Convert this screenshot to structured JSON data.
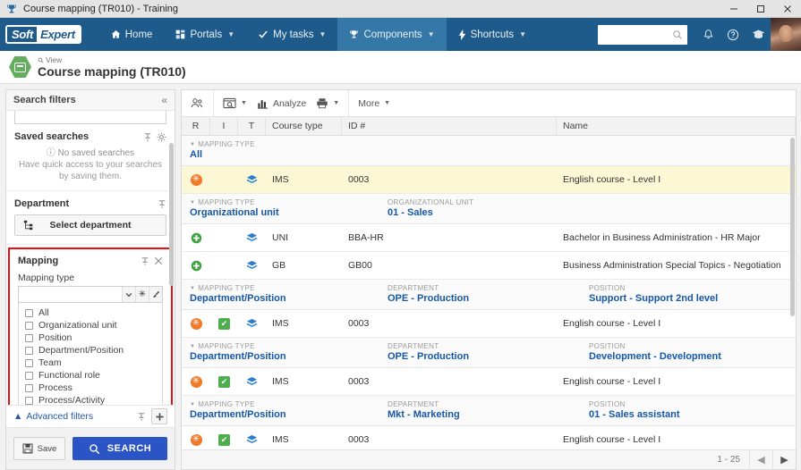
{
  "window": {
    "title": "Course mapping (TR010) - Training",
    "icon": "trophy-icon",
    "minimize": "─",
    "maximize": "☐",
    "close": "✕"
  },
  "nav": {
    "logo_left": "Soft",
    "logo_right": "Expert",
    "items": [
      {
        "label": "Home",
        "icon": "home-icon",
        "caret": false,
        "active": false
      },
      {
        "label": "Portals",
        "icon": "grid-icon",
        "caret": true,
        "active": false
      },
      {
        "label": "My tasks",
        "icon": "check-icon",
        "caret": true,
        "active": false
      },
      {
        "label": "Components",
        "icon": "trophy-icon",
        "caret": true,
        "active": true
      },
      {
        "label": "Shortcuts",
        "icon": "bolt-icon",
        "caret": true,
        "active": false
      }
    ],
    "search_placeholder": "",
    "search_value": "",
    "icons": [
      "search-icon",
      "bell-icon",
      "help-icon",
      "academy-icon",
      "avatar"
    ]
  },
  "page": {
    "breadcrumb": "View",
    "title": "Course mapping (TR010)"
  },
  "filters": {
    "header": "Search filters",
    "collapse_icon": "chevron-double-left-icon",
    "saved_searches": {
      "title": "Saved searches",
      "empty_title": "No saved searches",
      "empty_text": "Have quick access to your searches by saving them.",
      "tools": [
        "pin-icon",
        "gear-icon"
      ]
    },
    "department": {
      "title": "Department",
      "button_label": "Select department",
      "button_icon": "hierarchy-icon",
      "tools": [
        "pin-icon"
      ]
    },
    "mapping": {
      "title": "Mapping",
      "highlighted": true,
      "highlight_color": "#f00d0d",
      "tools": [
        "pin-icon",
        "close-icon"
      ],
      "field_label": "Mapping type",
      "field_value": "",
      "field_adornments": [
        "chevron-down-icon",
        "asterisk-icon",
        "brush-icon"
      ],
      "options": [
        {
          "label": "All",
          "checked": false
        },
        {
          "label": "Organizational unit",
          "checked": false
        },
        {
          "label": "Position",
          "checked": false
        },
        {
          "label": "Department/Position",
          "checked": false
        },
        {
          "label": "Team",
          "checked": false
        },
        {
          "label": "Functional role",
          "checked": false
        },
        {
          "label": "Process",
          "checked": false
        },
        {
          "label": "Process/Activity",
          "checked": false
        }
      ]
    },
    "advanced": {
      "label": "Advanced filters",
      "caret_icon": "caret-up-icon",
      "tools": [
        "pin-icon",
        "plus-icon"
      ]
    },
    "actions": {
      "save_label": "Save",
      "save_icon": "floppy-icon",
      "search_label": "SEARCH",
      "search_icon": "search-icon",
      "search_color": "#2b54c4"
    }
  },
  "grid": {
    "toolbar": [
      {
        "name": "assign-users-icon",
        "label": "",
        "caret": false
      },
      {
        "name": "report-icon",
        "label": "",
        "caret": true
      },
      {
        "name": "analyze-icon",
        "label": "Analyze",
        "caret": false
      },
      {
        "name": "print-icon",
        "label": "",
        "caret": true
      },
      {
        "name": "more-menu",
        "label": "More",
        "caret": true
      }
    ],
    "columns": [
      "R",
      "I",
      "T",
      "Course type",
      "ID #",
      "Name"
    ],
    "sections": [
      {
        "group": {
          "mapping_type_label": "MAPPING TYPE",
          "mapping_type_value": "All",
          "field2_label": "",
          "field2_value": "",
          "field3_label": "",
          "field3_value": ""
        },
        "rows": [
          {
            "r": "orange-asterisk-icon",
            "i": "",
            "t": "blue-layers-icon",
            "course_type": "IMS",
            "id": "0003",
            "name": "English course - Level I",
            "highlighted": true
          }
        ]
      },
      {
        "group": {
          "mapping_type_label": "MAPPING TYPE",
          "mapping_type_value": "Organizational unit",
          "field2_label": "ORGANIZATIONAL UNIT",
          "field2_value": "01 - Sales",
          "field3_label": "",
          "field3_value": ""
        },
        "rows": [
          {
            "r": "green-plus-icon",
            "i": "",
            "t": "blue-layers-icon",
            "course_type": "UNI",
            "id": "BBA-HR",
            "name": "Bachelor in Business Administration - HR Major",
            "highlighted": false
          },
          {
            "r": "green-plus-icon",
            "i": "",
            "t": "blue-layers-icon",
            "course_type": "GB",
            "id": "GB00",
            "name": "Business Administration Special Topics - Negotiation",
            "highlighted": false
          }
        ]
      },
      {
        "group": {
          "mapping_type_label": "MAPPING TYPE",
          "mapping_type_value": "Department/Position",
          "field2_label": "DEPARTMENT",
          "field2_value": "OPE - Production",
          "field3_label": "POSITION",
          "field3_value": "Support - Support 2nd level"
        },
        "rows": [
          {
            "r": "orange-asterisk-icon",
            "i": "green-check-icon",
            "t": "blue-layers-icon",
            "course_type": "IMS",
            "id": "0003",
            "name": "English course - Level I",
            "highlighted": false
          }
        ]
      },
      {
        "group": {
          "mapping_type_label": "MAPPING TYPE",
          "mapping_type_value": "Department/Position",
          "field2_label": "DEPARTMENT",
          "field2_value": "OPE - Production",
          "field3_label": "POSITION",
          "field3_value": "Development - Development"
        },
        "rows": [
          {
            "r": "orange-asterisk-icon",
            "i": "green-check-icon",
            "t": "blue-layers-icon",
            "course_type": "IMS",
            "id": "0003",
            "name": "English course - Level I",
            "highlighted": false
          }
        ]
      },
      {
        "group": {
          "mapping_type_label": "MAPPING TYPE",
          "mapping_type_value": "Department/Position",
          "field2_label": "DEPARTMENT",
          "field2_value": "Mkt - Marketing",
          "field3_label": "POSITION",
          "field3_value": "01 - Sales assistant"
        },
        "rows": [
          {
            "r": "orange-asterisk-icon",
            "i": "green-check-icon",
            "t": "blue-layers-icon",
            "course_type": "IMS",
            "id": "0003",
            "name": "English course - Level I",
            "highlighted": false
          }
        ]
      }
    ],
    "pager": {
      "range": "1 - 25",
      "prev_icon": "triangle-left-icon",
      "next_icon": "triangle-right-icon"
    }
  }
}
